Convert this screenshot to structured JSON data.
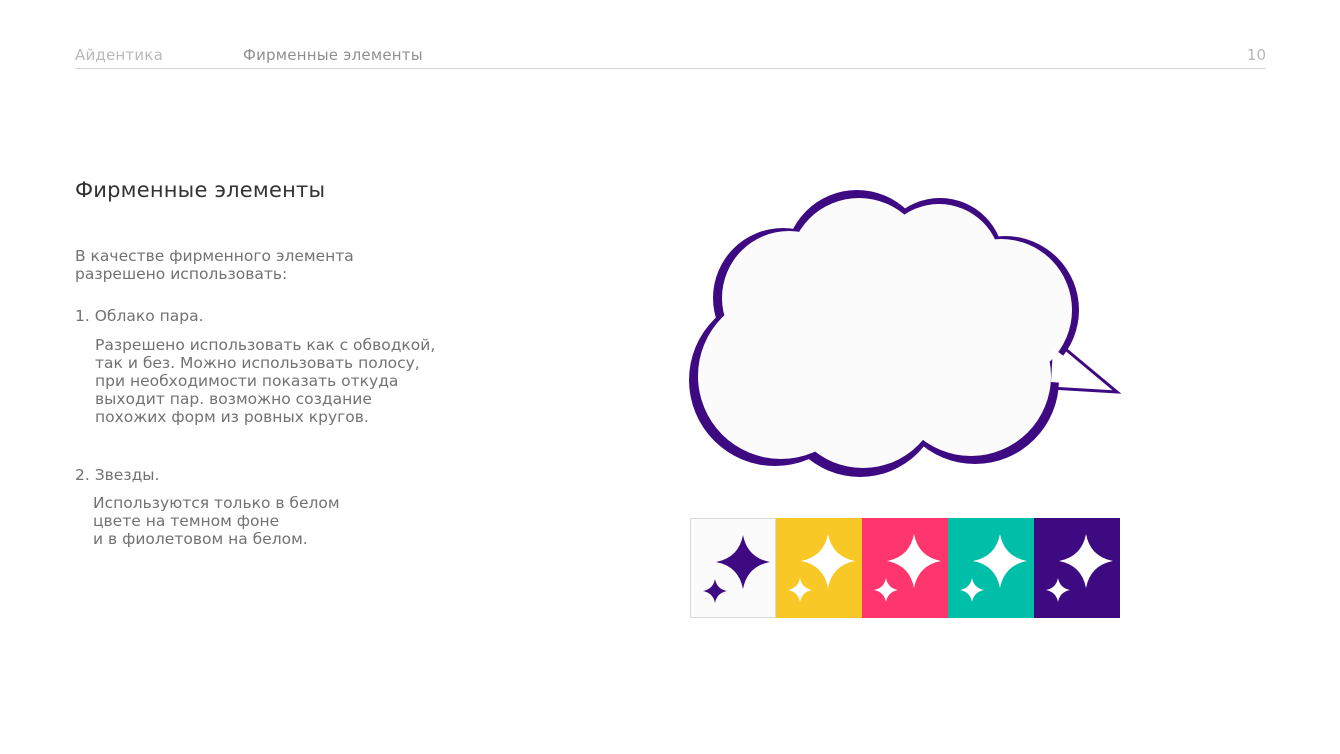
{
  "header": {
    "section": "Айдентика",
    "title": "Фирменные элементы",
    "page_number": "10"
  },
  "content": {
    "heading": "Фирменные элементы",
    "intro": [
      "В качестве фирменного элемента",
      "разрешено использовать:"
    ],
    "items": [
      {
        "title": "1. Облако пара.",
        "description": [
          "Разрешено использовать как с обводкой,",
          "так и без. Можно использовать полосу,",
          "при необходимости показать откуда",
          "выходит пар. возможно создание",
          "похожих форм из ровных кругов."
        ]
      },
      {
        "title": "2. Звезды.",
        "description": [
          "Используются только в белом",
          "цвете на темном фоне",
          "и в фиолетовом на белом."
        ]
      }
    ]
  },
  "colors": {
    "purple": "#3d0a82",
    "swatches": [
      {
        "background": "#fbfbfb",
        "star": "#3d0a82",
        "border": "#d9d9d9"
      },
      {
        "background": "#f8c926",
        "star": "#ffffff"
      },
      {
        "background": "#ff356e",
        "star": "#ffffff"
      },
      {
        "background": "#00bfa8",
        "star": "#ffffff"
      },
      {
        "background": "#3d0a82",
        "star": "#ffffff"
      }
    ]
  },
  "icons": {
    "cloud": "steam-cloud-icon",
    "star": "sparkle-stars-icon"
  }
}
